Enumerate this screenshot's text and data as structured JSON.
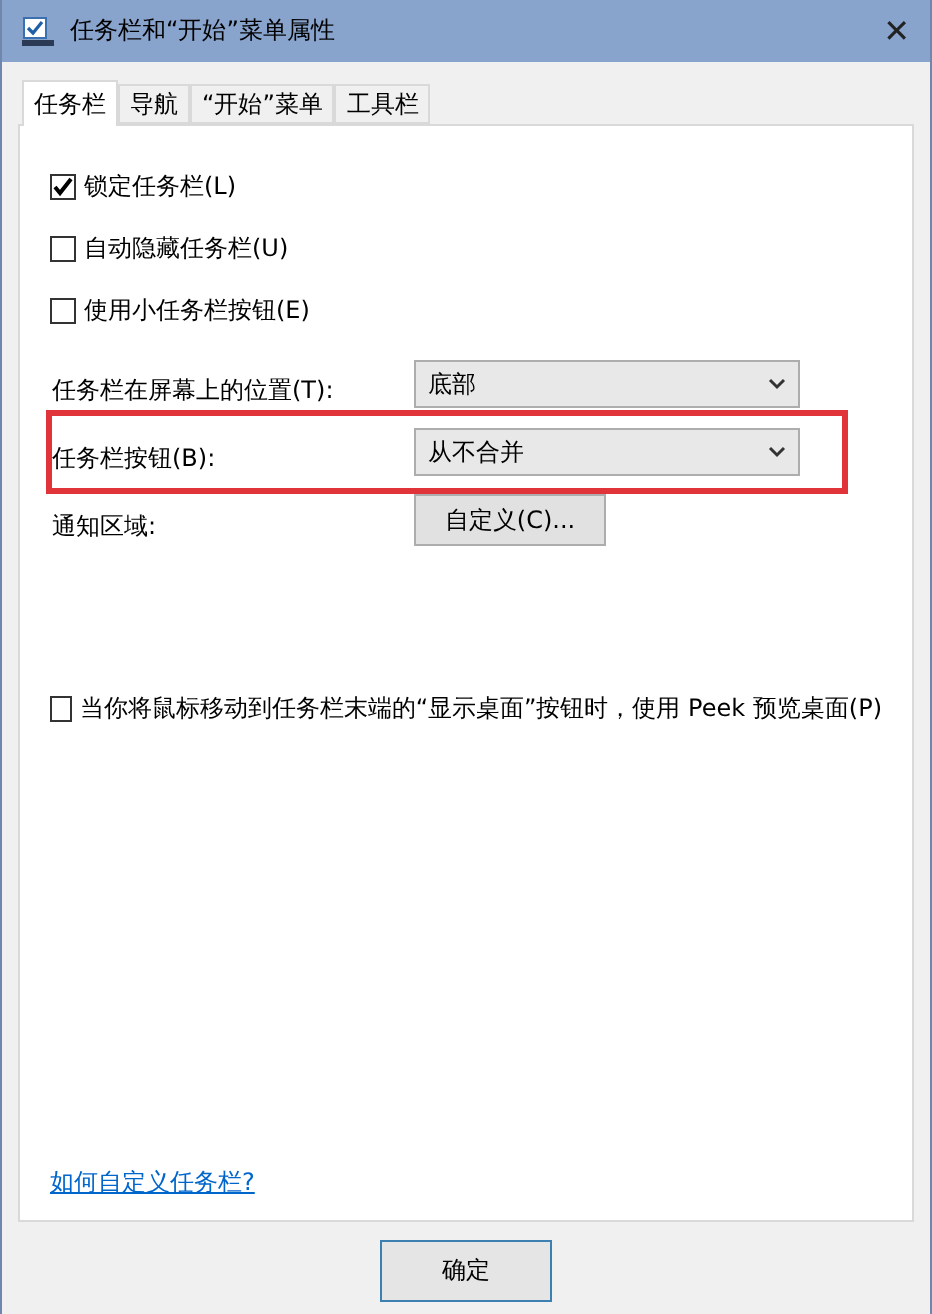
{
  "window": {
    "title": "任务栏和“开始”菜单属性",
    "close": "✕"
  },
  "tabs": [
    {
      "label": "任务栏",
      "selected": true
    },
    {
      "label": "导航",
      "selected": false
    },
    {
      "label": "“开始”菜单",
      "selected": false
    },
    {
      "label": "工具栏",
      "selected": false
    }
  ],
  "options": [
    {
      "label": "锁定任务栏(L)",
      "checked": true
    },
    {
      "label": "自动隐藏任务栏(U)",
      "checked": false
    },
    {
      "label": "使用小任务栏按钮(E)",
      "checked": false
    }
  ],
  "settings": [
    {
      "kind": "select",
      "label": "任务栏在屏幕上的位置(T):",
      "value": "底部",
      "highlighted": false
    },
    {
      "kind": "select",
      "label": "任务栏按钮(B):",
      "value": "从不合并",
      "highlighted": true
    },
    {
      "kind": "button",
      "label": "通知区域:",
      "value": "自定义(C)...",
      "highlighted": false
    }
  ],
  "peek": {
    "label": "当你将鼠标移动到任务栏末端的“显示桌面”按钮时，使用 Peek 预览桌面(P)",
    "checked": false
  },
  "help_link": "如何自定义任务栏?",
  "buttons": [
    "确定"
  ]
}
